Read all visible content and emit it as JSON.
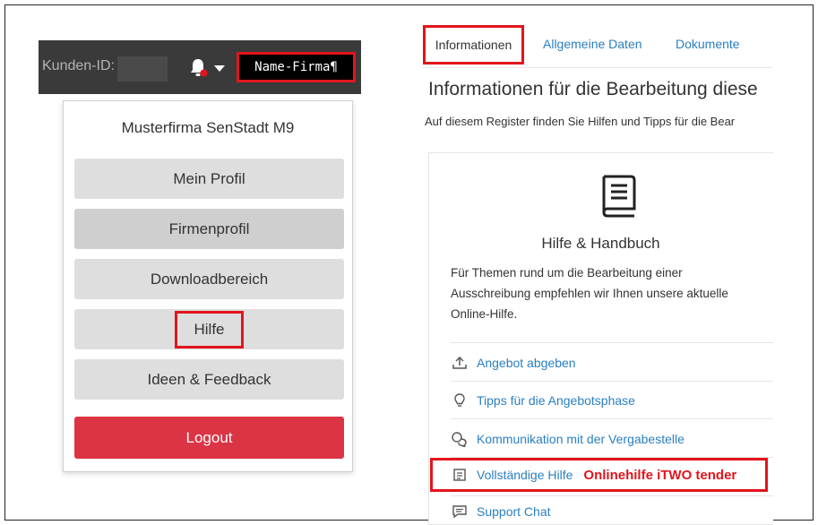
{
  "header": {
    "customer_id_label": "Kunden-ID:",
    "user_button_label": "Name-Firma¶"
  },
  "dropdown": {
    "company_name": "Musterfirma SenStadt M9",
    "items": [
      {
        "label": "Mein Profil"
      },
      {
        "label": "Firmenprofil"
      },
      {
        "label": "Downloadbereich"
      },
      {
        "label": "Hilfe"
      },
      {
        "label": "Ideen & Feedback"
      }
    ],
    "logout_label": "Logout"
  },
  "tabs": [
    {
      "label": "Informationen",
      "active": true
    },
    {
      "label": "Allgemeine Daten",
      "active": false
    },
    {
      "label": "Dokumente",
      "active": false
    }
  ],
  "main": {
    "heading": "Informationen für die Bearbeitung diese",
    "subtext": "Auf diesem Register finden Sie Hilfen und Tipps für die Bear",
    "card": {
      "icon": "book-icon",
      "title": "Hilfe & Handbuch",
      "text": "Für Themen rund um die Bearbeitung einer Ausschreibung empfehlen wir Ihnen unsere aktuelle Online-Hilfe.",
      "links": [
        {
          "label": "Angebot abgeben",
          "icon": "upload-icon"
        },
        {
          "label": "Tipps für die Angebotsphase",
          "icon": "lightbulb-icon"
        },
        {
          "label": "Kommunikation mit der Vergabestelle",
          "icon": "chat-bubbles-icon"
        },
        {
          "label": "Vollständige Hilfe",
          "icon": "document-icon"
        },
        {
          "label": "Support Chat",
          "icon": "message-icon"
        }
      ]
    },
    "annotation": "Onlinehilfe iTWO tender"
  },
  "colors": {
    "highlight": "#e3141c",
    "link": "#2a7fc1",
    "logout": "#db3444",
    "topbar": "#3a3a3a"
  }
}
